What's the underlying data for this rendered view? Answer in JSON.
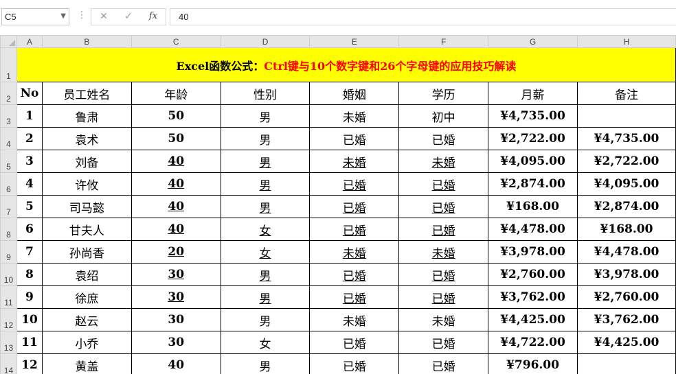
{
  "formula_bar": {
    "name_box": "C5",
    "more_icon": "⋮",
    "cancel_icon": "✕",
    "enter_icon": "✓",
    "fx_label": "fx",
    "value": "40"
  },
  "columns": [
    "A",
    "B",
    "C",
    "D",
    "E",
    "F",
    "G",
    "H"
  ],
  "row_numbers": [
    "1",
    "2",
    "3",
    "4",
    "5",
    "6",
    "7",
    "8",
    "9",
    "10",
    "11",
    "12",
    "13",
    "14"
  ],
  "title": {
    "black": "Excel函数公式：",
    "red": "Ctrl键与10个数字键和26个字母键的应用技巧解读"
  },
  "headers": [
    "No",
    "员工姓名",
    "年龄",
    "性别",
    "婚姻",
    "学历",
    "月薪",
    "备注"
  ],
  "rows": [
    {
      "no": "1",
      "name": "鲁肃",
      "age": "50",
      "gender": "男",
      "marital": "未婚",
      "edu": "初中",
      "salary": "¥4,735.00",
      "note": ""
    },
    {
      "no": "2",
      "name": "袁术",
      "age": "50",
      "gender": "男",
      "marital": "已婚",
      "edu": "已婚",
      "salary": "¥2,722.00",
      "note": "¥4,735.00"
    },
    {
      "no": "3",
      "name": "刘备",
      "age": "40",
      "gender": "男",
      "marital": "未婚",
      "edu": "未婚",
      "salary": "¥4,095.00",
      "note": "¥2,722.00"
    },
    {
      "no": "4",
      "name": "许攸",
      "age": "40",
      "gender": "男",
      "marital": "已婚",
      "edu": "已婚",
      "salary": "¥2,874.00",
      "note": "¥4,095.00"
    },
    {
      "no": "5",
      "name": "司马懿",
      "age": "40",
      "gender": "男",
      "marital": "已婚",
      "edu": "已婚",
      "salary": "¥168.00",
      "note": "¥2,874.00"
    },
    {
      "no": "6",
      "name": "甘夫人",
      "age": "40",
      "gender": "女",
      "marital": "已婚",
      "edu": "已婚",
      "salary": "¥4,478.00",
      "note": "¥168.00"
    },
    {
      "no": "7",
      "name": "孙尚香",
      "age": "20",
      "gender": "女",
      "marital": "未婚",
      "edu": "未婚",
      "salary": "¥3,978.00",
      "note": "¥4,478.00"
    },
    {
      "no": "8",
      "name": "袁绍",
      "age": "30",
      "gender": "男",
      "marital": "已婚",
      "edu": "已婚",
      "salary": "¥2,760.00",
      "note": "¥3,978.00"
    },
    {
      "no": "9",
      "name": "徐庶",
      "age": "30",
      "gender": "男",
      "marital": "已婚",
      "edu": "已婚",
      "salary": "¥3,762.00",
      "note": "¥2,760.00"
    },
    {
      "no": "10",
      "name": "赵云",
      "age": "30",
      "gender": "男",
      "marital": "未婚",
      "edu": "未婚",
      "salary": "¥4,425.00",
      "note": "¥3,762.00"
    },
    {
      "no": "11",
      "name": "小乔",
      "age": "30",
      "gender": "女",
      "marital": "已婚",
      "edu": "已婚",
      "salary": "¥4,722.00",
      "note": "¥4,425.00"
    },
    {
      "no": "12",
      "name": "黄盖",
      "age": "40",
      "gender": "男",
      "marital": "已婚",
      "edu": "已婚",
      "salary": "¥796.00",
      "note": ""
    }
  ],
  "colors": {
    "title_bg": "#ffff00",
    "title_red": "#ff0000",
    "grid_header_bg": "#e6e6e6"
  }
}
